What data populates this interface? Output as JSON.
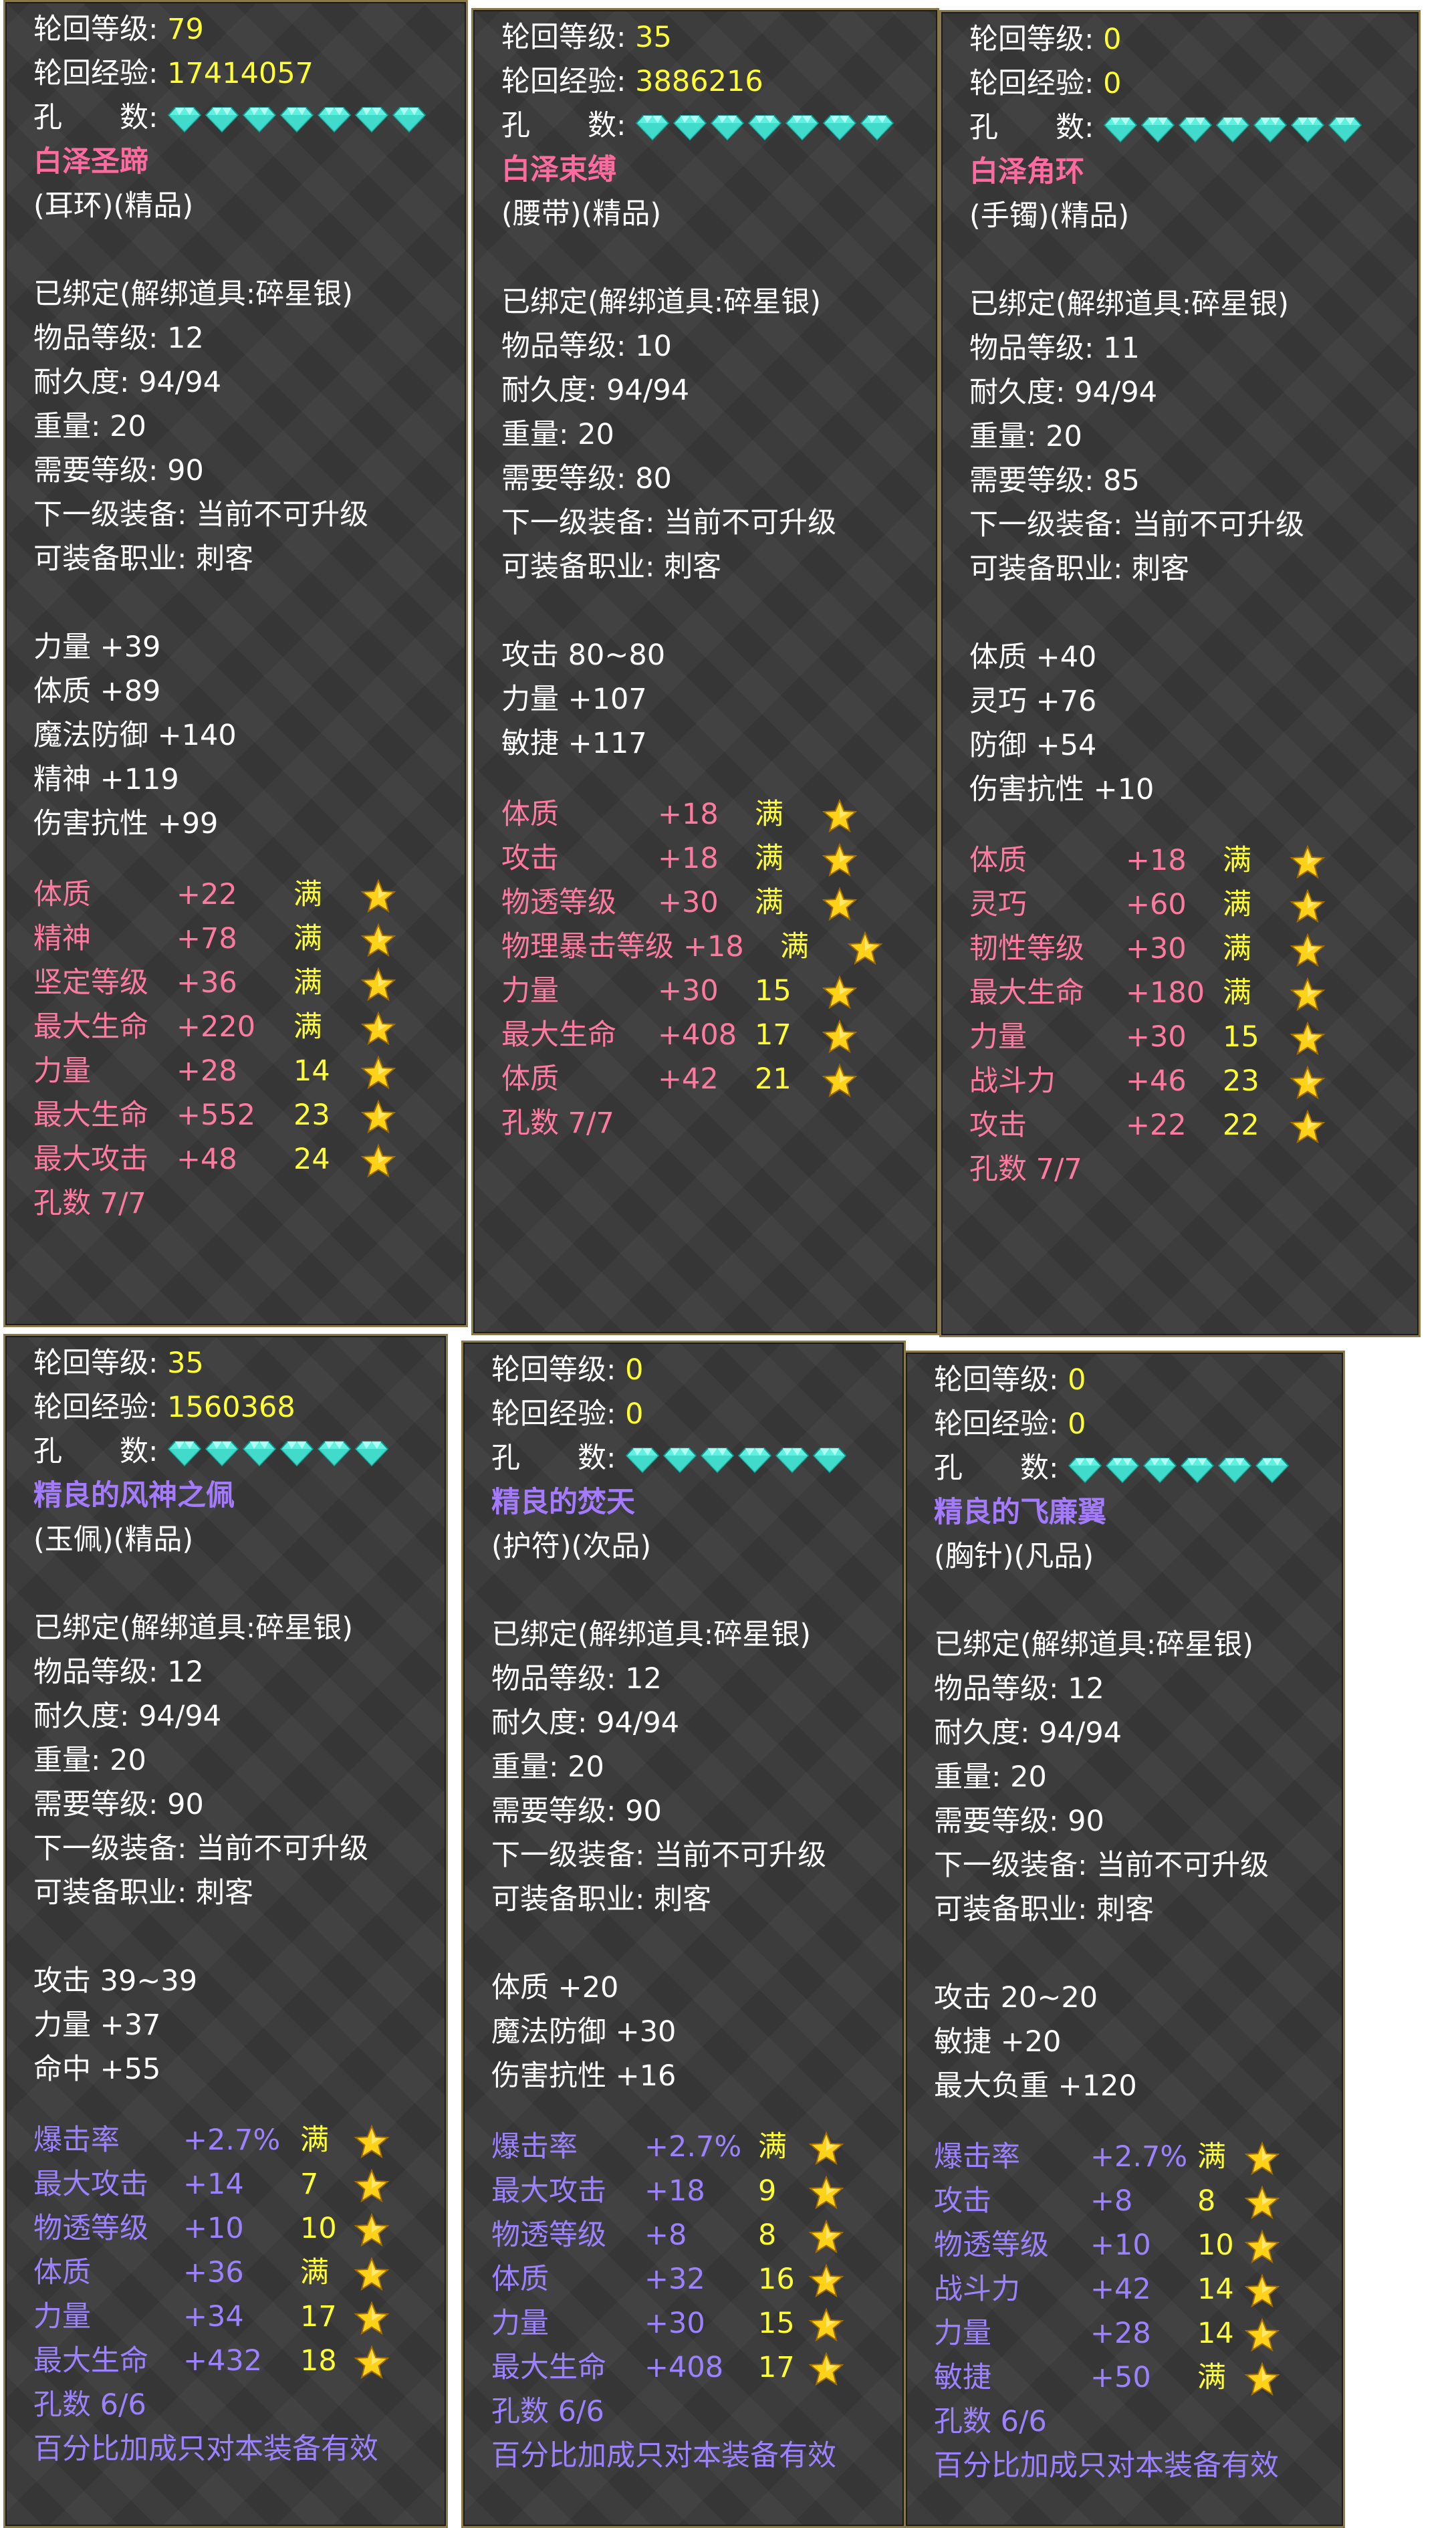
{
  "labels": {
    "reinc_level": "轮回等级:",
    "reinc_exp": "轮回经验:",
    "holes": "孔　　数:",
    "bound": "已绑定(解绑道具:碎星银)",
    "item_level": "物品等级:",
    "durability": "耐久度:",
    "weight": "重量:",
    "req_level": "需要等级:",
    "next_equip": "下一级装备: 当前不可升级",
    "job": "可装备职业: 刺客",
    "pct_note": "百分比加成只对本装备有效"
  },
  "colors": {
    "gold_value": "#ffff33",
    "name_pink": "#ff6b9e",
    "name_purple": "#a47bff",
    "refine_pink": "#ff7aa0",
    "refine_purple": "#9c82ff",
    "gem": "#5ff0e0",
    "star": "#ffd21a",
    "border": "#8a7a4a"
  },
  "icons": {
    "gem": "diamond-gem-icon",
    "star": "gold-star-icon"
  },
  "panels": [
    {
      "reinc_level": "79",
      "reinc_exp": "17414057",
      "gems": 7,
      "name": "白泽圣蹄",
      "type": "(耳环)(精品)",
      "item_level": "12",
      "durability": "94/94",
      "weight": "20",
      "req_level": "90",
      "base_stats": [
        "力量 +39",
        "体质 +89",
        "魔法防御 +140",
        "精神 +119",
        "伤害抗性 +99"
      ],
      "refines": [
        {
          "name": "体质",
          "value": "+22",
          "level": "满"
        },
        {
          "name": "精神",
          "value": "+78",
          "level": "满"
        },
        {
          "name": "坚定等级",
          "value": "+36",
          "level": "满"
        },
        {
          "name": "最大生命",
          "value": "+220",
          "level": "满"
        },
        {
          "name": "力量",
          "value": "+28",
          "level": "14"
        },
        {
          "name": "最大生命",
          "value": "+552",
          "level": "23"
        },
        {
          "name": "最大攻击",
          "value": "+48",
          "level": "24"
        }
      ],
      "holes_count": "孔数 7/7"
    },
    {
      "reinc_level": "35",
      "reinc_exp": "3886216",
      "gems": 7,
      "name": "白泽束缚",
      "type": "(腰带)(精品)",
      "item_level": "10",
      "durability": "94/94",
      "weight": "20",
      "req_level": "80",
      "base_stats": [
        "攻击 80~80",
        "力量 +107",
        "敏捷 +117"
      ],
      "refines": [
        {
          "name": "体质",
          "value": "+18",
          "level": "满"
        },
        {
          "name": "攻击",
          "value": "+18",
          "level": "满"
        },
        {
          "name": "物透等级",
          "value": "+30",
          "level": "满"
        },
        {
          "name": "物理暴击等级",
          "value": "+18",
          "level": "满"
        },
        {
          "name": "力量",
          "value": "+30",
          "level": "15"
        },
        {
          "name": "最大生命",
          "value": "+408",
          "level": "17"
        },
        {
          "name": "体质",
          "value": "+42",
          "level": "21"
        }
      ],
      "holes_count": "孔数 7/7"
    },
    {
      "reinc_level": "0",
      "reinc_exp": "0",
      "gems": 7,
      "name": "白泽角环",
      "type": "(手镯)(精品)",
      "item_level": "11",
      "durability": "94/94",
      "weight": "20",
      "req_level": "85",
      "base_stats": [
        "体质 +40",
        "灵巧 +76",
        "防御 +54",
        "伤害抗性 +10"
      ],
      "refines": [
        {
          "name": "体质",
          "value": "+18",
          "level": "满"
        },
        {
          "name": "灵巧",
          "value": "+60",
          "level": "满"
        },
        {
          "name": "韧性等级",
          "value": "+30",
          "level": "满"
        },
        {
          "name": "最大生命",
          "value": "+180",
          "level": "满"
        },
        {
          "name": "力量",
          "value": "+30",
          "level": "15"
        },
        {
          "name": "战斗力",
          "value": "+46",
          "level": "23"
        },
        {
          "name": "攻击",
          "value": "+22",
          "level": "22"
        }
      ],
      "holes_count": "孔数 7/7"
    },
    {
      "reinc_level": "35",
      "reinc_exp": "1560368",
      "gems": 6,
      "name": "精良的风神之佩",
      "type": "(玉佩)(精品)",
      "item_level": "12",
      "durability": "94/94",
      "weight": "20",
      "req_level": "90",
      "base_stats": [
        "攻击 39~39",
        "力量 +37",
        "命中 +55"
      ],
      "refines": [
        {
          "name": "爆击率",
          "value": "+2.7%",
          "level": "满"
        },
        {
          "name": "最大攻击",
          "value": "+14",
          "level": "7"
        },
        {
          "name": "物透等级",
          "value": "+10",
          "level": "10"
        },
        {
          "name": "体质",
          "value": "+36",
          "level": "满"
        },
        {
          "name": "力量",
          "value": "+34",
          "level": "17"
        },
        {
          "name": "最大生命",
          "value": "+432",
          "level": "18"
        }
      ],
      "holes_count": "孔数 6/6"
    },
    {
      "reinc_level": "0",
      "reinc_exp": "0",
      "gems": 6,
      "name": "精良的焚天",
      "type": "(护符)(次品)",
      "item_level": "12",
      "durability": "94/94",
      "weight": "20",
      "req_level": "90",
      "base_stats": [
        "体质 +20",
        "魔法防御 +30",
        "伤害抗性 +16"
      ],
      "refines": [
        {
          "name": "爆击率",
          "value": "+2.7%",
          "level": "满"
        },
        {
          "name": "最大攻击",
          "value": "+18",
          "level": "9"
        },
        {
          "name": "物透等级",
          "value": "+8",
          "level": "8"
        },
        {
          "name": "体质",
          "value": "+32",
          "level": "16"
        },
        {
          "name": "力量",
          "value": "+30",
          "level": "15"
        },
        {
          "name": "最大生命",
          "value": "+408",
          "level": "17"
        }
      ],
      "holes_count": "孔数 6/6"
    },
    {
      "reinc_level": "0",
      "reinc_exp": "0",
      "gems": 6,
      "name": "精良的飞廉翼",
      "type": "(胸针)(凡品)",
      "item_level": "12",
      "durability": "94/94",
      "weight": "20",
      "req_level": "90",
      "base_stats": [
        "攻击 20~20",
        "敏捷 +20",
        "最大负重 +120"
      ],
      "refines": [
        {
          "name": "爆击率",
          "value": "+2.7%",
          "level": "满"
        },
        {
          "name": "攻击",
          "value": "+8",
          "level": "8"
        },
        {
          "name": "物透等级",
          "value": "+10",
          "level": "10"
        },
        {
          "name": "战斗力",
          "value": "+42",
          "level": "14"
        },
        {
          "name": "力量",
          "value": "+28",
          "level": "14"
        },
        {
          "name": "敏捷",
          "value": "+50",
          "level": "满"
        }
      ],
      "holes_count": "孔数 6/6"
    }
  ]
}
